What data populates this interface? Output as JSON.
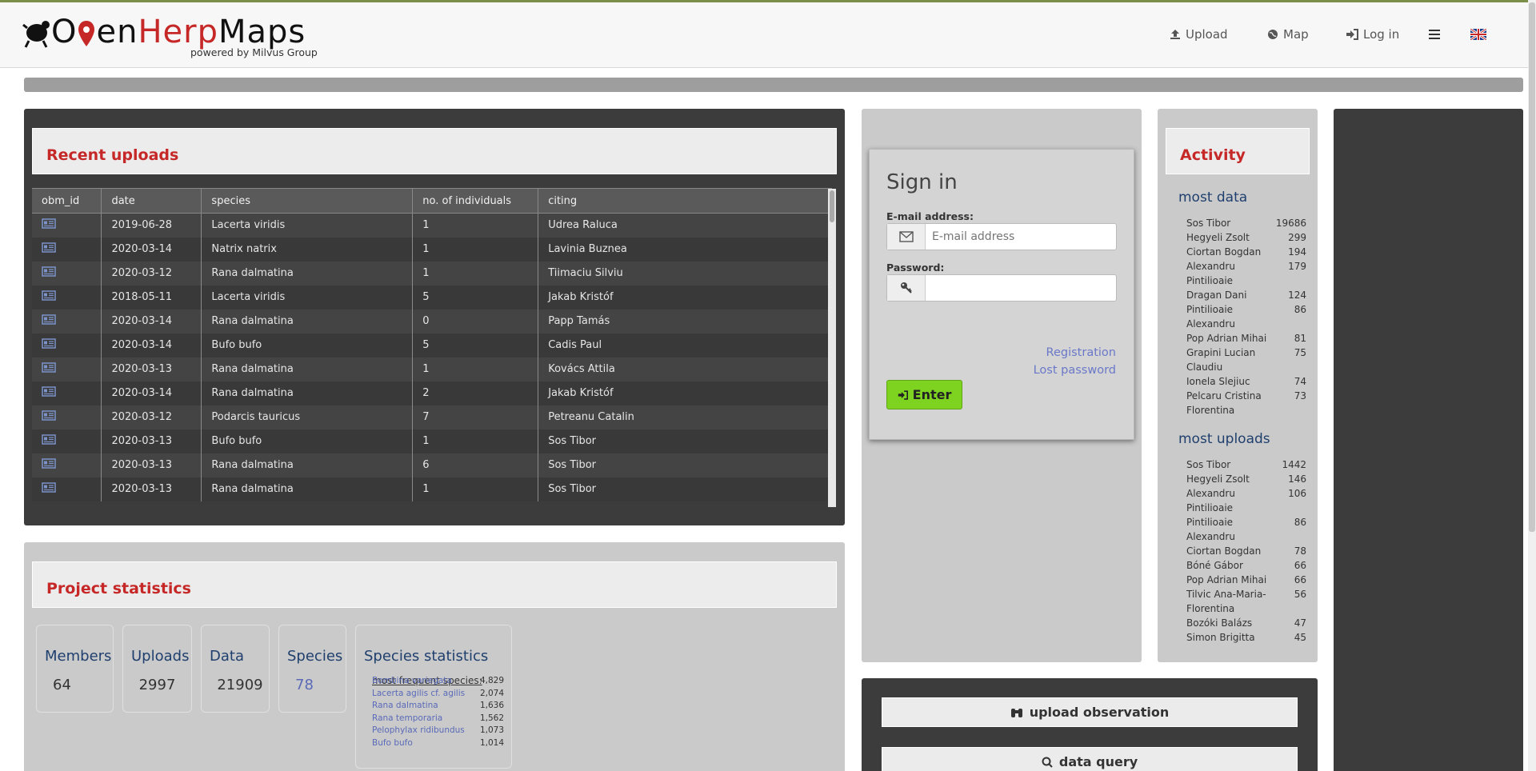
{
  "brand": {
    "title_part1": "O",
    "title_part2": "enHerpMaps",
    "title_part3": "",
    "logo_a": "O",
    "logo_p": "en",
    "logo_herp": "Herp",
    "logo_maps": "Maps",
    "subtitle": "powered by Milvus Group"
  },
  "nav": {
    "upload": "Upload",
    "map": "Map",
    "login": "Log in"
  },
  "recent_uploads": {
    "title": "Recent uploads",
    "columns": [
      "obm_id",
      "date",
      "species",
      "no. of individuals",
      "citing"
    ],
    "rows": [
      {
        "date": "2019-06-28",
        "species": "Lacerta viridis",
        "count": "1",
        "citing": "Udrea Raluca"
      },
      {
        "date": "2020-03-14",
        "species": "Natrix natrix",
        "count": "1",
        "citing": "Lavinia Buznea"
      },
      {
        "date": "2020-03-12",
        "species": "Rana dalmatina",
        "count": "1",
        "citing": "Tiimaciu Silviu"
      },
      {
        "date": "2018-05-11",
        "species": "Lacerta viridis",
        "count": "5",
        "citing": "Jakab Kristóf"
      },
      {
        "date": "2020-03-14",
        "species": "Rana dalmatina",
        "count": "0",
        "citing": "Papp Tamás"
      },
      {
        "date": "2020-03-14",
        "species": "Bufo bufo",
        "count": "5",
        "citing": "Cadis Paul"
      },
      {
        "date": "2020-03-13",
        "species": "Rana dalmatina",
        "count": "1",
        "citing": "Kovács Attila"
      },
      {
        "date": "2020-03-14",
        "species": "Rana dalmatina",
        "count": "2",
        "citing": "Jakab Kristóf"
      },
      {
        "date": "2020-03-12",
        "species": "Podarcis tauricus",
        "count": "7",
        "citing": "Petreanu Catalin"
      },
      {
        "date": "2020-03-13",
        "species": "Bufo bufo",
        "count": "1",
        "citing": "Sos Tibor"
      },
      {
        "date": "2020-03-13",
        "species": "Rana dalmatina",
        "count": "6",
        "citing": "Sos Tibor"
      },
      {
        "date": "2020-03-13",
        "species": "Rana dalmatina",
        "count": "1",
        "citing": "Sos Tibor"
      }
    ]
  },
  "project_statistics": {
    "title": "Project statistics",
    "members_label": "Members",
    "members_value": "64",
    "uploads_label": "Uploads",
    "uploads_value": "2997",
    "data_label": "Data",
    "data_value": "21909",
    "species_label": "Species",
    "species_value": "78",
    "species_stats_label": "Species statistics",
    "most_frequent_label": "most frequent species:",
    "most_frequent": [
      {
        "name": "Bombina variegata",
        "count": "4,829"
      },
      {
        "name": "Lacerta agilis cf. agilis",
        "count": "2,074"
      },
      {
        "name": "Rana dalmatina",
        "count": "1,636"
      },
      {
        "name": "Rana temporaria",
        "count": "1,562"
      },
      {
        "name": "Pelophylax ridibundus",
        "count": "1,073"
      },
      {
        "name": "Bufo bufo",
        "count": "1,014"
      }
    ]
  },
  "signin": {
    "title": "Sign in",
    "email_label": "E-mail address:",
    "email_placeholder": "E-mail address",
    "password_label": "Password:",
    "registration": "Registration",
    "lost_password": "Lost password",
    "enter": "Enter"
  },
  "activity": {
    "title": "Activity",
    "most_data_label": "most data",
    "most_data": [
      {
        "name": "Sos Tibor",
        "value": "19686"
      },
      {
        "name": "Hegyeli Zsolt",
        "value": "299"
      },
      {
        "name": "Ciortan Bogdan",
        "value": "194"
      },
      {
        "name": "Alexandru Pintilioaie",
        "value": "179"
      },
      {
        "name": "Dragan Dani",
        "value": "124"
      },
      {
        "name": "Pintilioaie Alexandru",
        "value": "86"
      },
      {
        "name": "Pop Adrian Mihai",
        "value": "81"
      },
      {
        "name": "Grapini Lucian Claudiu",
        "value": "75"
      },
      {
        "name": "Ionela Slejiuc",
        "value": "74"
      },
      {
        "name": "Pelcaru Cristina Florentina",
        "value": "73"
      }
    ],
    "most_uploads_label": "most uploads",
    "most_uploads": [
      {
        "name": "Sos Tibor",
        "value": "1442"
      },
      {
        "name": "Hegyeli Zsolt",
        "value": "146"
      },
      {
        "name": "Alexandru Pintilioaie",
        "value": "106"
      },
      {
        "name": "Pintilioaie Alexandru",
        "value": "86"
      },
      {
        "name": "Ciortan Bogdan",
        "value": "78"
      },
      {
        "name": "Bóné Gábor",
        "value": "66"
      },
      {
        "name": "Pop Adrian Mihai",
        "value": "66"
      },
      {
        "name": "Tilvic Ana-Maria-Florentina",
        "value": "56"
      },
      {
        "name": "Bozóki Balázs",
        "value": "47"
      },
      {
        "name": "Simon Brigitta",
        "value": "45"
      }
    ]
  },
  "actions": {
    "upload_observation": "upload observation",
    "data_query": "data query"
  },
  "colors": {
    "accent_red": "#c62828",
    "link_blue": "#6a78c8",
    "heading_blue": "#1f3f6e",
    "enter_green": "#7ed321"
  }
}
